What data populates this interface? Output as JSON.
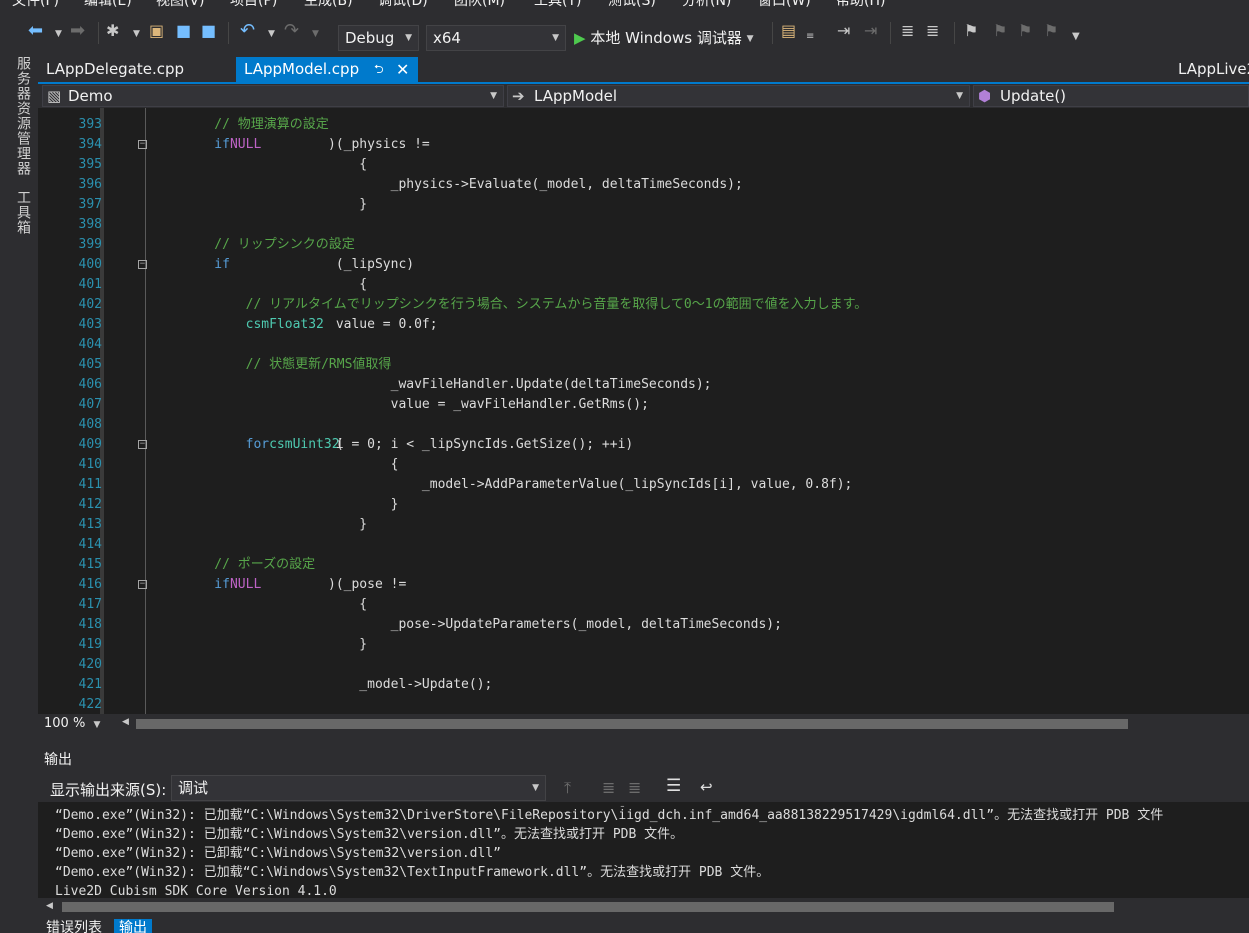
{
  "menu": [
    "文件(F)",
    "编辑(E)",
    "视图(V)",
    "项目(P)",
    "生成(B)",
    "调试(D)",
    "团队(M)",
    "工具(T)",
    "测试(S)",
    "分析(N)",
    "窗口(W)",
    "帮助(H)"
  ],
  "toolbar": {
    "config": "Debug",
    "platform": "x64",
    "run_label": "本地 Windows 调试器"
  },
  "left_tabs": [
    "服务器资源管理器",
    "工具箱"
  ],
  "tabs": {
    "first": "LAppDelegate.cpp",
    "active": "LAppModel.cpp",
    "right": "LAppLive2"
  },
  "nav": {
    "project": "Demo",
    "class": "LAppModel",
    "member": "Update()"
  },
  "code_lines": [
    {
      "n": "393",
      "parts": [
        [
          "cm",
          "    // 物理演算の設定"
        ]
      ]
    },
    {
      "n": "394",
      "fold": true,
      "parts": [
        [
          "kw",
          "    if"
        ],
        [
          "tx",
          " (_physics != "
        ],
        [
          "mac",
          "NULL"
        ],
        [
          "tx",
          ")"
        ]
      ]
    },
    {
      "n": "395",
      "parts": [
        [
          "tx",
          "    {"
        ]
      ]
    },
    {
      "n": "396",
      "parts": [
        [
          "tx",
          "        _physics->Evaluate(_model, deltaTimeSeconds);"
        ]
      ]
    },
    {
      "n": "397",
      "parts": [
        [
          "tx",
          "    }"
        ]
      ]
    },
    {
      "n": "398",
      "parts": [
        [
          "tx",
          ""
        ]
      ]
    },
    {
      "n": "399",
      "parts": [
        [
          "cm",
          "    // リップシンクの設定"
        ]
      ]
    },
    {
      "n": "400",
      "fold": true,
      "parts": [
        [
          "kw",
          "    if"
        ],
        [
          "tx",
          " (_lipSync)"
        ]
      ]
    },
    {
      "n": "401",
      "parts": [
        [
          "tx",
          "    {"
        ]
      ]
    },
    {
      "n": "402",
      "parts": [
        [
          "cm",
          "        // リアルタイムでリップシンクを行う場合、システムから音量を取得して0～1の範囲で値を入力します。"
        ]
      ]
    },
    {
      "n": "403",
      "parts": [
        [
          "ty",
          "        csmFloat32"
        ],
        [
          "tx",
          " value = 0.0f;"
        ]
      ]
    },
    {
      "n": "404",
      "parts": [
        [
          "tx",
          ""
        ]
      ]
    },
    {
      "n": "405",
      "parts": [
        [
          "cm",
          "        // 状態更新/RMS値取得"
        ]
      ]
    },
    {
      "n": "406",
      "parts": [
        [
          "tx",
          "        _wavFileHandler.Update(deltaTimeSeconds);"
        ]
      ]
    },
    {
      "n": "407",
      "parts": [
        [
          "tx",
          "        value = _wavFileHandler.GetRms();"
        ]
      ]
    },
    {
      "n": "408",
      "parts": [
        [
          "tx",
          ""
        ]
      ]
    },
    {
      "n": "409",
      "fold": true,
      "parts": [
        [
          "kw",
          "        for"
        ],
        [
          "tx",
          " ("
        ],
        [
          "ty",
          "csmUint32"
        ],
        [
          "tx",
          " i = 0; i < _lipSyncIds.GetSize(); ++i)"
        ]
      ]
    },
    {
      "n": "410",
      "parts": [
        [
          "tx",
          "        {"
        ]
      ]
    },
    {
      "n": "411",
      "parts": [
        [
          "tx",
          "            _model->AddParameterValue(_lipSyncIds[i], value, 0.8f);"
        ]
      ]
    },
    {
      "n": "412",
      "parts": [
        [
          "tx",
          "        }"
        ]
      ]
    },
    {
      "n": "413",
      "parts": [
        [
          "tx",
          "    }"
        ]
      ]
    },
    {
      "n": "414",
      "parts": [
        [
          "tx",
          ""
        ]
      ]
    },
    {
      "n": "415",
      "parts": [
        [
          "cm",
          "    // ポーズの設定"
        ]
      ]
    },
    {
      "n": "416",
      "fold": true,
      "parts": [
        [
          "kw",
          "    if"
        ],
        [
          "tx",
          " (_pose != "
        ],
        [
          "mac",
          "NULL"
        ],
        [
          "tx",
          ")"
        ]
      ]
    },
    {
      "n": "417",
      "parts": [
        [
          "tx",
          "    {"
        ]
      ]
    },
    {
      "n": "418",
      "parts": [
        [
          "tx",
          "        _pose->UpdateParameters(_model, deltaTimeSeconds);"
        ]
      ]
    },
    {
      "n": "419",
      "parts": [
        [
          "tx",
          "    }"
        ]
      ]
    },
    {
      "n": "420",
      "parts": [
        [
          "tx",
          ""
        ]
      ]
    },
    {
      "n": "421",
      "parts": [
        [
          "tx",
          "    _model->Update();"
        ]
      ]
    },
    {
      "n": "422",
      "parts": [
        [
          "tx",
          ""
        ]
      ]
    }
  ],
  "zoom": "100 %",
  "output": {
    "title": "输出",
    "source_label": "显示输出来源(S):",
    "source": "调试",
    "lines": [
      "“Demo.exe”(Win32): 已加载“C:\\Windows\\System32\\DriverStore\\FileRepository\\iigd_dch.inf_amd64_aa88138229517429\\igdml64.dll”。无法查找或打开 PDB 文件",
      "“Demo.exe”(Win32): 已加载“C:\\Windows\\System32\\version.dll”。无法查找或打开 PDB 文件。",
      "“Demo.exe”(Win32): 已卸载“C:\\Windows\\System32\\version.dll”",
      "“Demo.exe”(Win32): 已加载“C:\\Windows\\System32\\TextInputFramework.dll”。无法查找或打开 PDB 文件。",
      "Live2D Cubism SDK Core Version 4.1.0"
    ]
  },
  "bottom_tabs": [
    "错误列表",
    "输出"
  ],
  "colors": {
    "accent": "#007acc",
    "keyword": "#569cd6",
    "comment": "#57a64a",
    "macro": "#bd63c5",
    "type": "#4ec9b0",
    "line_number": "#2b91af"
  }
}
